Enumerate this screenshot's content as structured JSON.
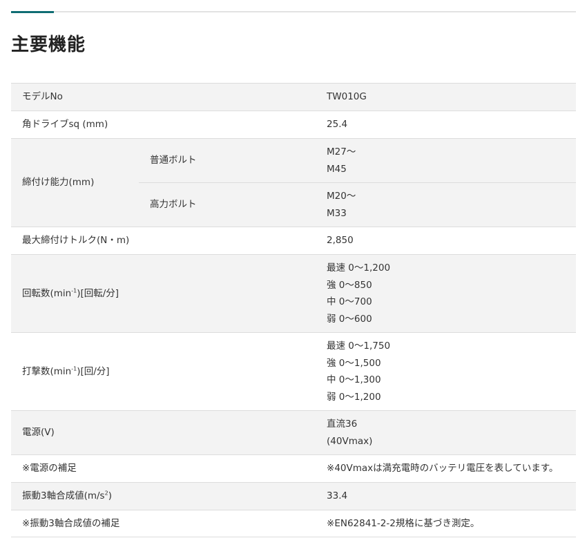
{
  "section_title": "主要機能",
  "specs": {
    "model": {
      "label": "モデルNo",
      "value": "TW010G"
    },
    "square_drive": {
      "label": "角ドライブsq (mm)",
      "value": "25.4"
    },
    "fastening": {
      "label": "締付け能力(mm)",
      "regular": {
        "sublabel": "普通ボルト",
        "lines": [
          "M27～",
          "M45"
        ]
      },
      "high_tensile": {
        "sublabel": "高力ボルト",
        "lines": [
          "M20～",
          "M33"
        ]
      }
    },
    "max_torque": {
      "label": "最大締付けトルク(N・m)",
      "value": "2,850"
    },
    "rotation": {
      "label_pre": "回転数(min",
      "label_sup": "-1",
      "label_post": ")[回転/分]",
      "lines": [
        "最速 0～1,200",
        "強 0～850",
        "中 0～700",
        "弱 0～600"
      ]
    },
    "impacts": {
      "label_pre": "打撃数(min",
      "label_sup": "-1",
      "label_post": ")[回/分]",
      "lines": [
        "最速 0～1,750",
        "強 0～1,500",
        "中 0～1,300",
        "弱 0～1,200"
      ]
    },
    "power": {
      "label": "電源(V)",
      "lines": [
        "直流36",
        "(40Vmax)"
      ]
    },
    "power_note": {
      "label": "※電源の補足",
      "value": "※40Vmaxは満充電時のバッテリ電圧を表しています。"
    },
    "vibration": {
      "label_pre": "振動3軸合成値(m/s",
      "label_sup": "2",
      "label_post": ")",
      "value": "33.4"
    },
    "vibration_note": {
      "label": "※振動3軸合成値の補足",
      "value": "※EN62841-2-2規格に基づき測定。"
    }
  }
}
